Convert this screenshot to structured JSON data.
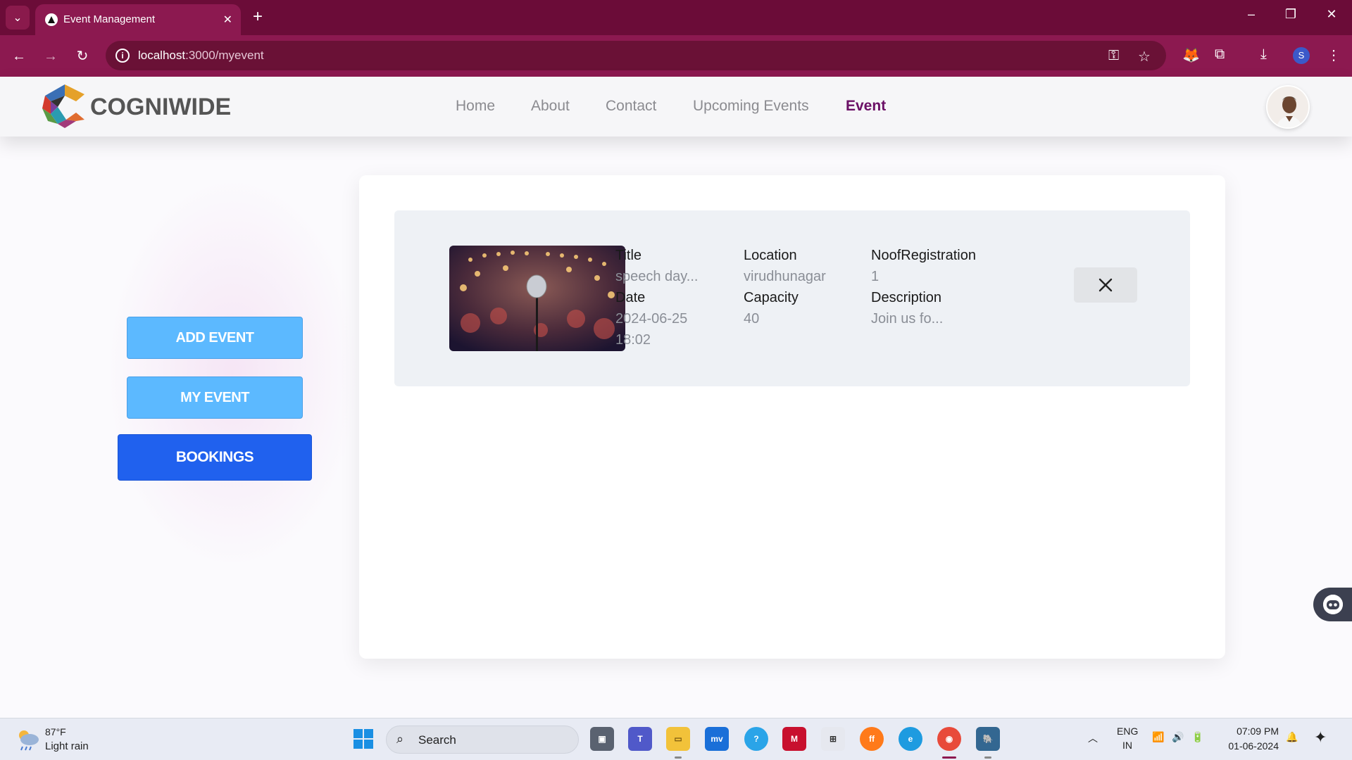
{
  "browser": {
    "tab_title": "Event Management",
    "url_host": "localhost",
    "url_path": ":3000/myevent",
    "profile_initial": "S"
  },
  "site": {
    "brand": "COGNIWIDE",
    "nav": [
      "Home",
      "About",
      "Contact",
      "Upcoming Events",
      "Event"
    ],
    "active_nav": "Event"
  },
  "sidebar": {
    "add_event": "ADD EVENT",
    "my_event": "MY EVENT",
    "bookings": "BOOKINGS"
  },
  "event": {
    "labels": {
      "title": "Title",
      "location": "Location",
      "registrations": "NoofRegistration",
      "date": "Date",
      "capacity": "Capacity",
      "description": "Description"
    },
    "values": {
      "title": "speech day...",
      "location": "virudhunagar",
      "registrations": "1",
      "date": "2024-06-25",
      "time": "18:02",
      "capacity": "40",
      "description": "Join us fo..."
    }
  },
  "taskbar": {
    "weather_temp": "87°F",
    "weather_desc": "Light rain",
    "search": "Search",
    "lang_top": "ENG",
    "lang_bottom": "IN",
    "time": "07:09 PM",
    "date": "01-06-2024"
  },
  "colors": {
    "browser_frame": "#6b0c38",
    "active_nav": "#6b1066",
    "btn_light": "#5cb9ff",
    "btn_dark": "#2061ee"
  }
}
